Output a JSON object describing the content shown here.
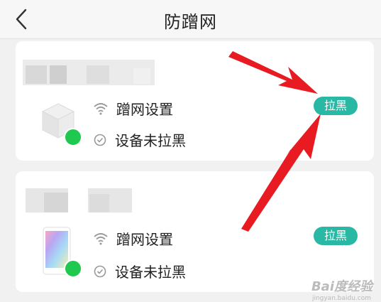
{
  "header": {
    "title": "防蹭网"
  },
  "devices": [
    {
      "wifi_label": "蹭网设置",
      "status_label": "设备未拉黑",
      "block_button": "拉黑"
    },
    {
      "wifi_label": "蹭网设置",
      "status_label": "设备未拉黑",
      "block_button": "拉黑"
    }
  ],
  "colors": {
    "accent": "#29b8a4",
    "online": "#1fc84f",
    "arrow": "#e81b23"
  },
  "watermark": {
    "text": "Bai度经验",
    "sub": "jingyan.baidu.com"
  }
}
